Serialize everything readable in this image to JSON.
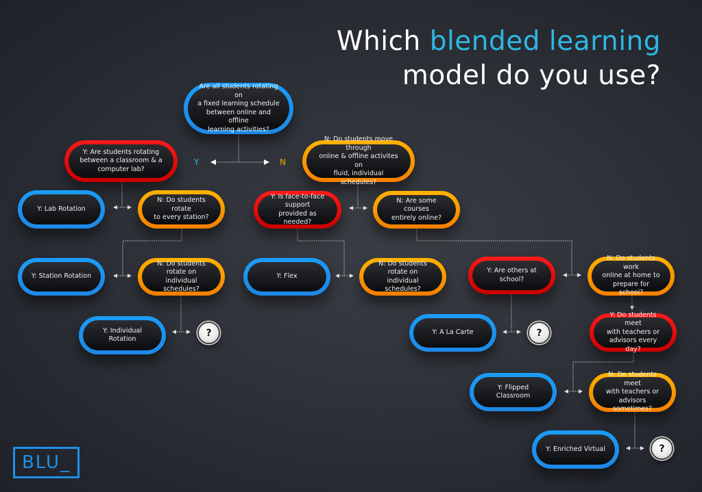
{
  "title": {
    "line1_prefix": "Which ",
    "line1_accent": "blended learning",
    "line2": "model do you use?"
  },
  "colors": {
    "accent": "#2fb7e3",
    "blue_node": "#1e88e5",
    "red_node": "#e00000",
    "orange_node": "#ffa000",
    "logo": "#1e90e8"
  },
  "branch_labels": {
    "yes": "Y",
    "no": "N"
  },
  "nodes": {
    "root": "Are all students rotating on\na fixed learning schedule\nbetween online and offline\nlearning activities?",
    "y_classroom_lab": "Y:   Are students rotating\nbetween a classroom & a\ncomputer lab?",
    "n_fluid_schedules": "N: Do students move through\nonline & offline activites on\nfluid, individual schedules?",
    "y_lab_rotation": "Y: Lab Rotation",
    "n_every_station": "N: Do students rotate\nto every station?",
    "y_face_to_face": "Y: Is face-to-face support\nprovided as needed?",
    "n_courses_online": "N: Are some courses\nentirely online?",
    "y_station_rotation": "Y: Station Rotation",
    "n_individual_schedules_1": "N: Do students rotate on\nindividual schedules?",
    "y_flex": "Y: Flex",
    "n_individual_schedules_2": "N: Do students rotate on\nindividual schedules?",
    "y_others_at_school": "Y: Are others at school?",
    "n_work_at_home": "N: Do students work\nonline at home to\nprepare for school?",
    "y_individual_rotation": "Y: Individual\nRotation",
    "y_a_la_carte": "Y: A La Carte",
    "y_meet_every_day": "Y: Do students meet\nwith teachers or\nadvisors every day?",
    "y_flipped_classroom": "Y: Flipped Classroom",
    "n_meet_sometimes": "N: Do students meet\nwith teachers or\nadvisors sometimes?",
    "y_enriched_virtual": "Y: Enriched Virtual"
  },
  "unknown_marker": "?",
  "logo_text": "BLU_"
}
